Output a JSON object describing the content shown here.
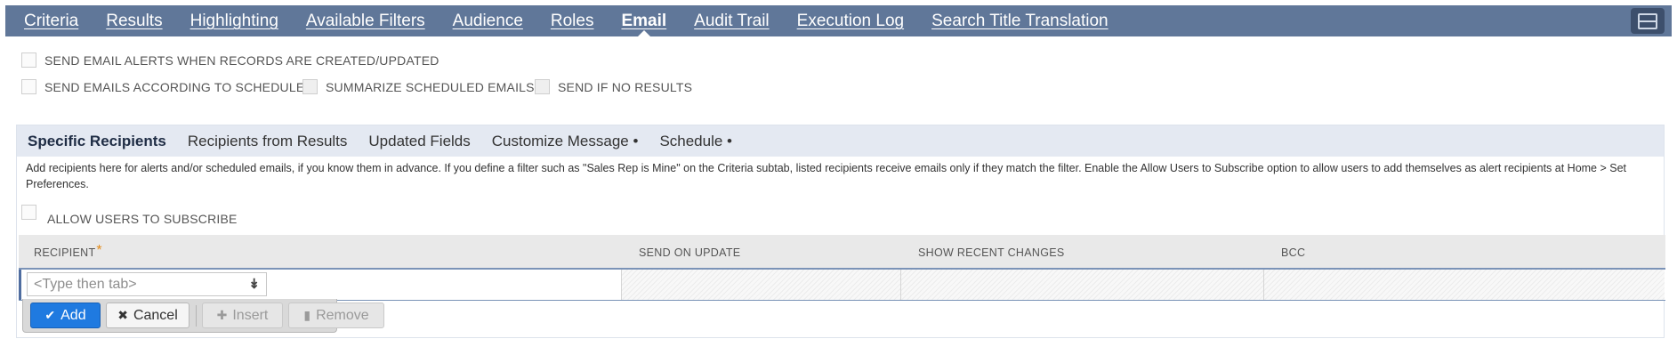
{
  "top_tabs": [
    {
      "label": "Criteria",
      "active": false
    },
    {
      "label": "Results",
      "active": false
    },
    {
      "label": "Highlighting",
      "active": false
    },
    {
      "label": "Available Filters",
      "active": false
    },
    {
      "label": "Audience",
      "active": false
    },
    {
      "label": "Roles",
      "active": false
    },
    {
      "label": "Email",
      "active": true
    },
    {
      "label": "Audit Trail",
      "active": false
    },
    {
      "label": "Execution Log",
      "active": false
    },
    {
      "label": "Search Title Translation",
      "active": false
    }
  ],
  "options": {
    "send_alerts": "SEND EMAIL ALERTS WHEN RECORDS ARE CREATED/UPDATED",
    "send_schedule": "SEND EMAILS ACCORDING TO SCHEDULE",
    "summarize": "SUMMARIZE SCHEDULED EMAILS",
    "send_no_results": "SEND IF NO RESULTS"
  },
  "subtabs": [
    {
      "label": "Specific Recipients",
      "active": true
    },
    {
      "label": "Recipients from Results",
      "active": false
    },
    {
      "label": "Updated Fields",
      "active": false
    },
    {
      "label": "Customize Message •",
      "active": false
    },
    {
      "label": "Schedule •",
      "active": false
    }
  ],
  "help_text": "Add recipients here for alerts and/or scheduled emails, if you know them in advance. If you define a filter such as \"Sales Rep is Mine\" on the Criteria subtab, listed recipients receive emails only if they match the filter. Enable the Allow Users to Subscribe option to allow users to add themselves as alert recipients at Home > Set Preferences.",
  "allow_subscribe": "ALLOW USERS TO SUBSCRIBE",
  "table": {
    "columns": [
      "RECIPIENT",
      "SEND ON UPDATE",
      "SHOW RECENT CHANGES",
      "BCC"
    ],
    "required_mark": "*",
    "recipient_placeholder": "<Type then tab>"
  },
  "buttons": {
    "add": "Add",
    "cancel": "Cancel",
    "insert": "Insert",
    "remove": "Remove"
  },
  "colors": {
    "topbar": "#607799",
    "subtab_bar": "#e4e9f2",
    "add_button": "#1f7ae0",
    "required": "#e38b1a"
  }
}
